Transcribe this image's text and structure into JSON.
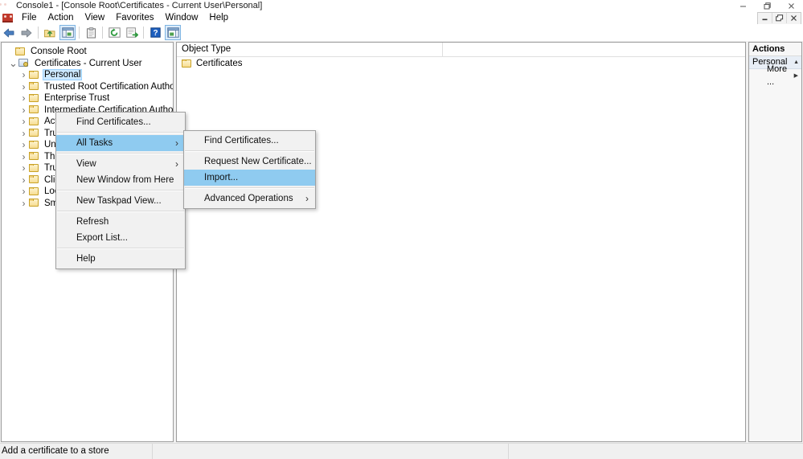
{
  "window": {
    "title": "Console1 - [Console Root\\Certificates - Current User\\Personal]",
    "app_icon": "mmc-console-icon",
    "controls": {
      "minimize": "minimize-icon",
      "restore": "restore-icon",
      "close": "close-icon"
    },
    "mdi_controls": {
      "minimize": "mdi-minimize-icon",
      "restore": "mdi-restore-icon",
      "close": "mdi-close-icon"
    }
  },
  "menubar": {
    "items": [
      {
        "label": "File"
      },
      {
        "label": "Action"
      },
      {
        "label": "View"
      },
      {
        "label": "Favorites"
      },
      {
        "label": "Window"
      },
      {
        "label": "Help"
      }
    ]
  },
  "toolbar": {
    "buttons": [
      {
        "name": "back-arrow-icon",
        "pressed": false
      },
      {
        "name": "forward-arrow-icon",
        "pressed": false
      },
      {
        "name": "up-folder-icon",
        "pressed": false
      },
      {
        "name": "show-hide-tree-icon",
        "pressed": true
      },
      {
        "name": "properties-icon",
        "pressed": false
      },
      {
        "name": "refresh-icon",
        "pressed": false
      },
      {
        "name": "export-list-icon",
        "pressed": false
      },
      {
        "name": "help-icon",
        "pressed": false
      },
      {
        "name": "show-hide-action-pane-icon",
        "pressed": true
      }
    ]
  },
  "tree": {
    "items": [
      {
        "label": "Console Root",
        "indent": 0,
        "expander": "",
        "icon": "folder-icon",
        "selected": false
      },
      {
        "label": "Certificates - Current User",
        "indent": 1,
        "expander": "v",
        "icon": "certificates-icon",
        "selected": false
      },
      {
        "label": "Personal",
        "indent": 2,
        "expander": ">",
        "icon": "folder-icon",
        "selected": true
      },
      {
        "label": "Trusted Root Certification Authorities",
        "indent": 2,
        "expander": ">",
        "icon": "folder-icon",
        "selected": false
      },
      {
        "label": "Enterprise Trust",
        "indent": 2,
        "expander": ">",
        "icon": "folder-icon",
        "selected": false
      },
      {
        "label": "Intermediate Certification Authorities",
        "indent": 2,
        "expander": ">",
        "icon": "folder-icon",
        "selected": false
      },
      {
        "label": "Active Directory User Object",
        "indent": 2,
        "expander": ">",
        "icon": "folder-icon",
        "selected": false
      },
      {
        "label": "Trusted Publishers",
        "indent": 2,
        "expander": ">",
        "icon": "folder-icon",
        "selected": false
      },
      {
        "label": "Untrusted Certificates",
        "indent": 2,
        "expander": ">",
        "icon": "folder-icon",
        "selected": false
      },
      {
        "label": "Third-Party Root Certification Authorities",
        "indent": 2,
        "expander": ">",
        "icon": "folder-icon",
        "selected": false
      },
      {
        "label": "Trusted People",
        "indent": 2,
        "expander": ">",
        "icon": "folder-icon",
        "selected": false
      },
      {
        "label": "Client Authentication Issuers",
        "indent": 2,
        "expander": ">",
        "icon": "folder-icon",
        "selected": false
      },
      {
        "label": "Local NonRemovable Certificates",
        "indent": 2,
        "expander": ">",
        "icon": "folder-icon",
        "selected": false
      },
      {
        "label": "Smart Card Trusted Roots",
        "indent": 2,
        "expander": ">",
        "icon": "folder-icon",
        "selected": false
      }
    ]
  },
  "list": {
    "columns": [
      "Object Type"
    ],
    "rows": [
      {
        "object_type": "Certificates",
        "icon": "folder-icon"
      }
    ]
  },
  "actions": {
    "header": "Actions",
    "group_label": "Personal",
    "group_collapse_icon": "chevron-up-icon",
    "items": [
      {
        "label": "More ...",
        "submenu_icon": "triangle-right-icon"
      }
    ]
  },
  "context_menu": {
    "items": [
      {
        "label": "Find Certificates...",
        "submenu": false,
        "highlight": false,
        "separator_after": true
      },
      {
        "label": "All Tasks",
        "submenu": true,
        "highlight": true,
        "separator_after": true
      },
      {
        "label": "View",
        "submenu": true,
        "highlight": false,
        "separator_after": false
      },
      {
        "label": "New Window from Here",
        "submenu": false,
        "highlight": false,
        "separator_after": true
      },
      {
        "label": "New Taskpad View...",
        "submenu": false,
        "highlight": false,
        "separator_after": true
      },
      {
        "label": "Refresh",
        "submenu": false,
        "highlight": false,
        "separator_after": false
      },
      {
        "label": "Export List...",
        "submenu": false,
        "highlight": false,
        "separator_after": true
      },
      {
        "label": "Help",
        "submenu": false,
        "highlight": false,
        "separator_after": false
      }
    ]
  },
  "submenu": {
    "items": [
      {
        "label": "Find Certificates...",
        "submenu": false,
        "highlight": false,
        "separator_after": true
      },
      {
        "label": "Request New Certificate...",
        "submenu": false,
        "highlight": false,
        "separator_after": false
      },
      {
        "label": "Import...",
        "submenu": false,
        "highlight": true,
        "separator_after": true
      },
      {
        "label": "Advanced Operations",
        "submenu": true,
        "highlight": false,
        "separator_after": false
      }
    ]
  },
  "statusbar": {
    "text": "Add a certificate to a store"
  },
  "colors": {
    "menu_highlight": "#8fcbf0",
    "tree_selection": "#cce8ff",
    "actions_group": "#e8eef6",
    "folder_yellow": "#f7dd93"
  }
}
